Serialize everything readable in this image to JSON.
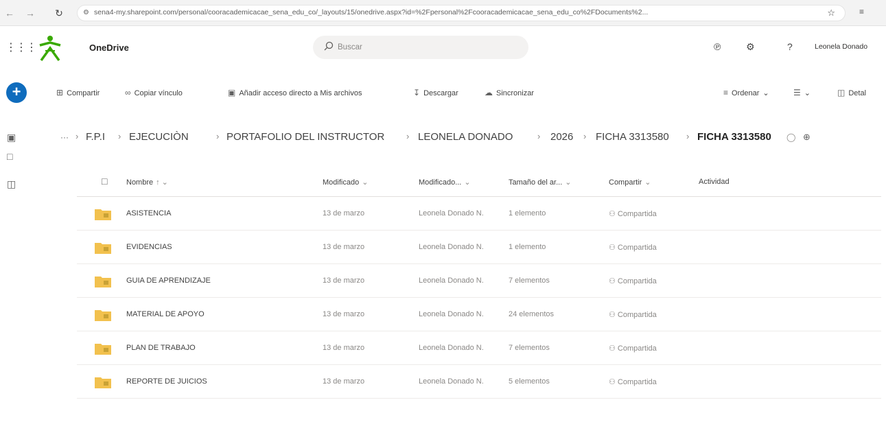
{
  "browser": {
    "url": "sena4-my.sharepoint.com/personal/cooracademicacae_sena_edu_co/_layouts/15/onedrive.aspx?id=%2Fpersonal%2Fcooracademicacae_sena_edu_co%2FDocuments%2..."
  },
  "header": {
    "app_name": "OneDrive",
    "search_placeholder": "Buscar",
    "user_name": "Leonela Donado"
  },
  "command_bar": {
    "share": "Compartir",
    "copy_link": "Copiar vínculo",
    "add_shortcut": "Añadir acceso directo a Mis archivos",
    "download": "Descargar",
    "sync": "Sincronizar",
    "sort": "Ordenar",
    "details": "Detal"
  },
  "breadcrumb": {
    "ellipsis": "···",
    "items": [
      "F.P.I",
      "EJECUCIÒN",
      "PORTAFOLIO DEL INSTRUCTOR",
      "LEONELA DONADO",
      "2026",
      "FICHA 3313580"
    ],
    "current": "FICHA 3313580"
  },
  "columns": {
    "name": "Nombre",
    "modified": "Modificado",
    "modified_by": "Modificado...",
    "size": "Tamaño del ar...",
    "share": "Compartir",
    "activity": "Actividad"
  },
  "rows": [
    {
      "name": "ASISTENCIA",
      "modified": "13 de marzo",
      "modified_by": "Leonela Donado N.",
      "size": "1 elemento",
      "share": "Compartida"
    },
    {
      "name": "EVIDENCIAS",
      "modified": "13 de marzo",
      "modified_by": "Leonela Donado N.",
      "size": "1 elemento",
      "share": "Compartida"
    },
    {
      "name": "GUIA DE APRENDIZAJE",
      "modified": "13 de marzo",
      "modified_by": "Leonela Donado N.",
      "size": "7 elementos",
      "share": "Compartida"
    },
    {
      "name": "MATERIAL DE APOYO",
      "modified": "13 de marzo",
      "modified_by": "Leonela Donado N.",
      "size": "24 elementos",
      "share": "Compartida"
    },
    {
      "name": "PLAN DE TRABAJO",
      "modified": "13 de marzo",
      "modified_by": "Leonela Donado N.",
      "size": "7 elementos",
      "share": "Compartida"
    },
    {
      "name": "REPORTE DE JUICIOS",
      "modified": "13 de marzo",
      "modified_by": "Leonela Donado N.",
      "size": "5 elementos",
      "share": "Compartida"
    }
  ],
  "colors": {
    "accent": "#0f6cbd",
    "folder": "#f2c14e",
    "logo": "#39a900"
  }
}
